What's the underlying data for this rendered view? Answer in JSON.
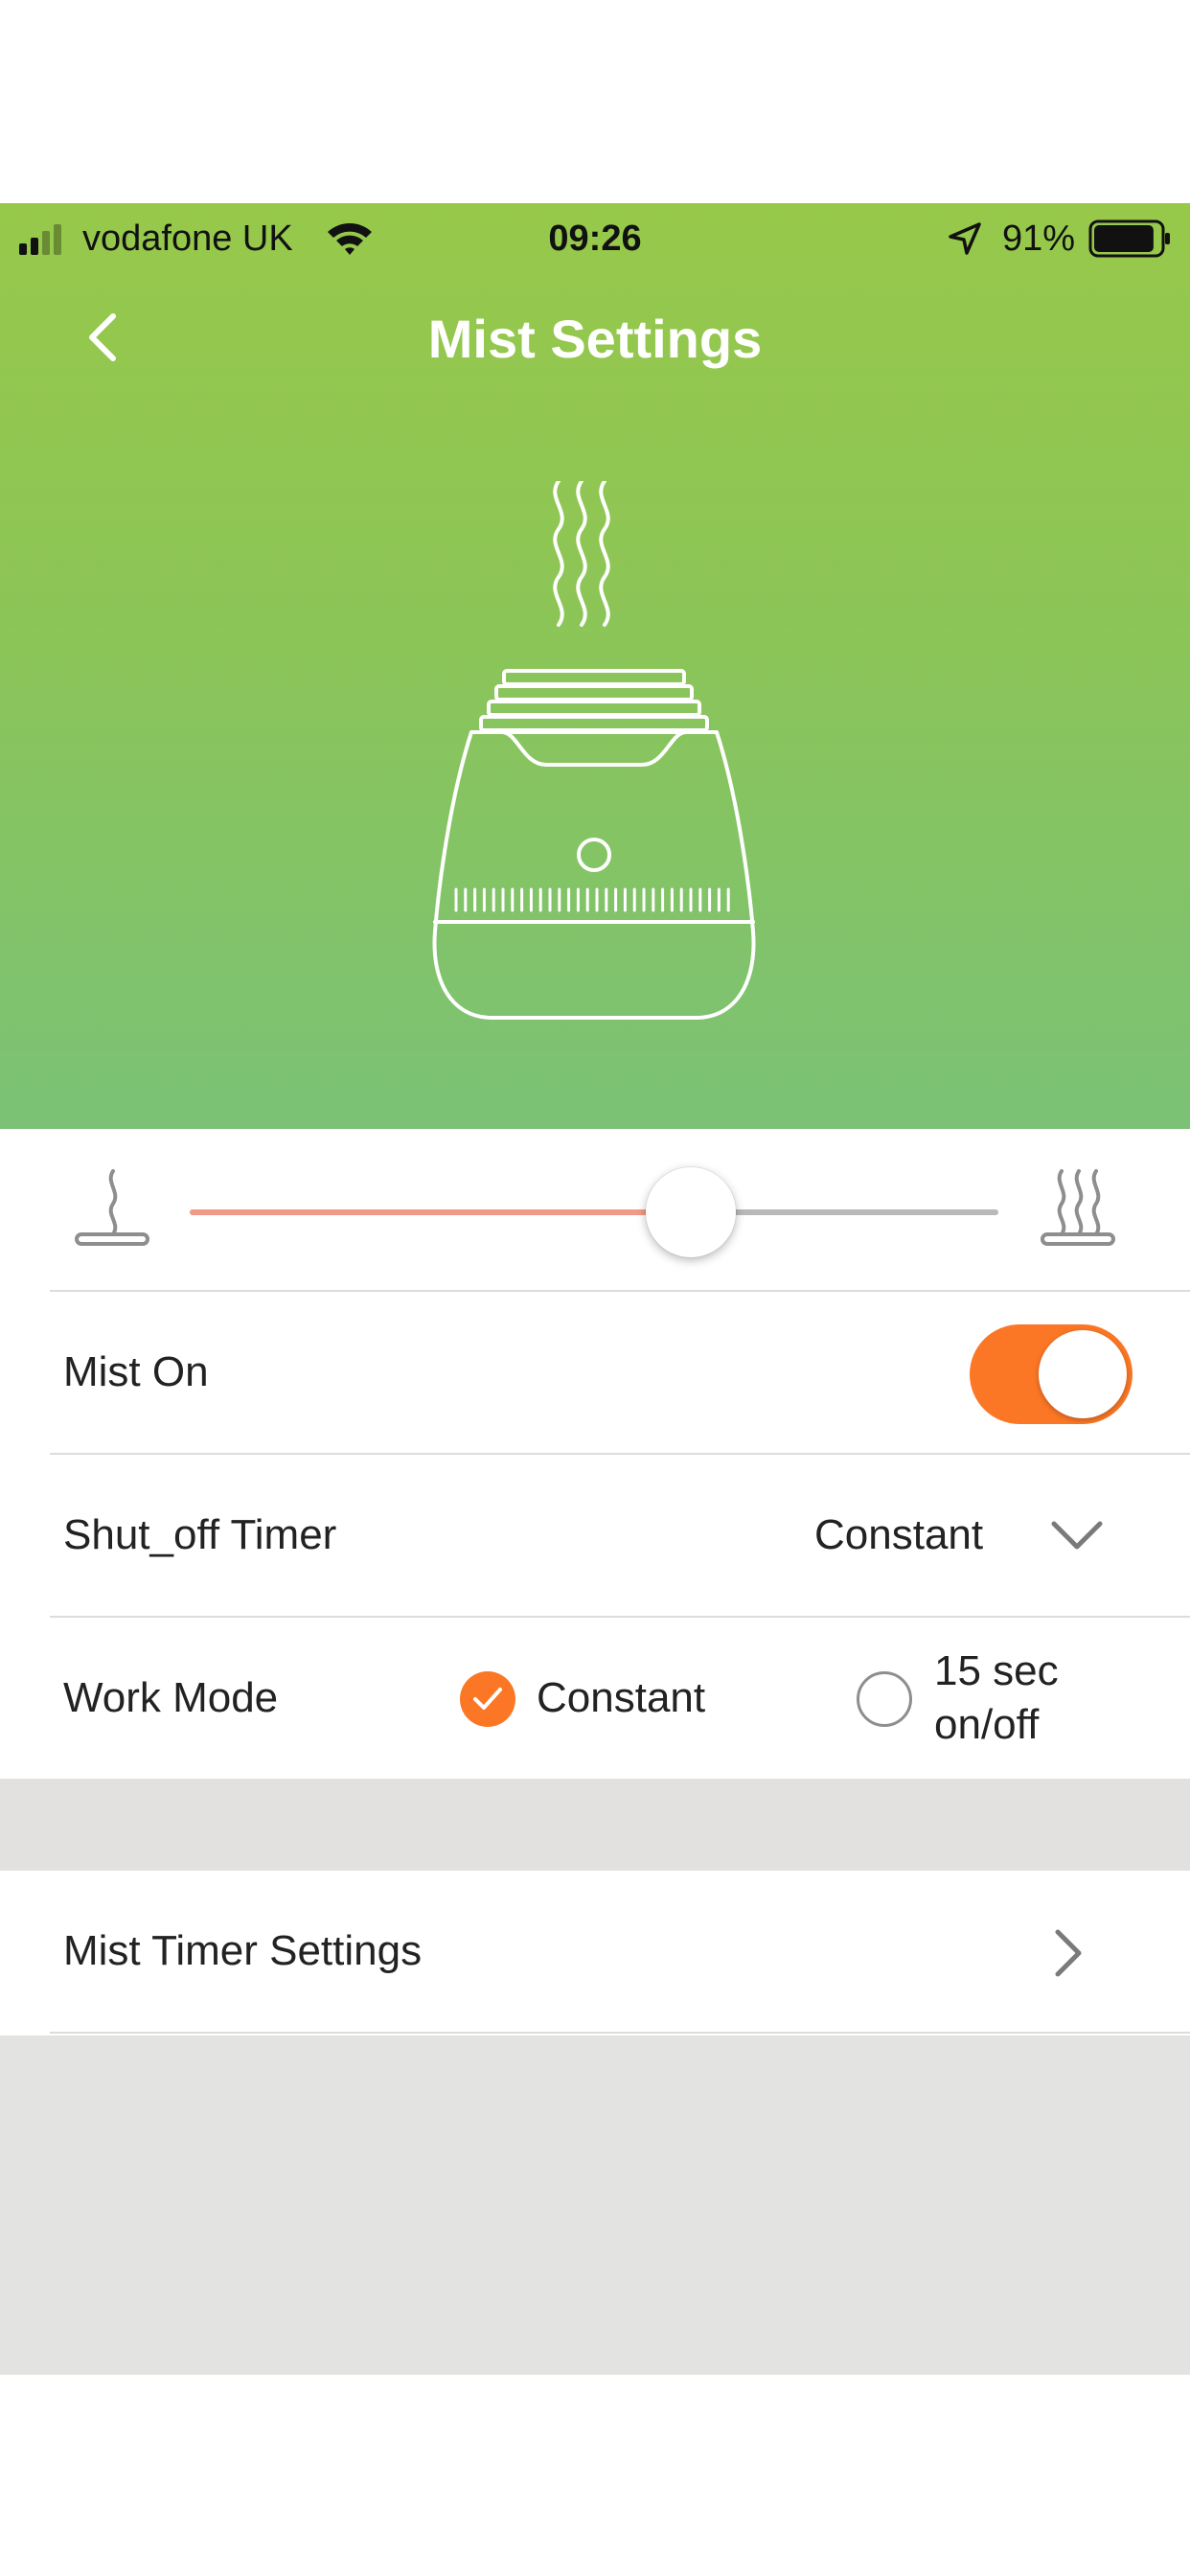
{
  "status_bar": {
    "carrier": "vodafone UK",
    "time": "09:26",
    "battery_percent": "91%",
    "battery_level": 0.91,
    "signal_bars_filled": 2,
    "signal_bars_total": 4
  },
  "header": {
    "title": "Mist Settings",
    "back_icon": "chevron-left-icon",
    "background_top": "#97c84a",
    "background_bottom": "#7bc276"
  },
  "device_illustration": {
    "icon": "humidifier-icon"
  },
  "mist_level": {
    "low_icon": "mist-low-icon",
    "high_icon": "mist-high-icon",
    "value_fraction": 0.62,
    "fill_color": "#f19a87"
  },
  "mist_on": {
    "label": "Mist On",
    "value": true,
    "accent": "#fb7725"
  },
  "shutoff_timer": {
    "label": "Shut_off Timer",
    "selected": "Constant",
    "icon": "chevron-down-icon"
  },
  "work_mode": {
    "label": "Work Mode",
    "options": [
      {
        "line1": "Constant",
        "line2": "",
        "checked": true
      },
      {
        "line1": "15 sec",
        "line2": "on/off",
        "checked": false
      }
    ]
  },
  "mist_timer_settings": {
    "label": "Mist Timer Settings",
    "icon": "chevron-right-icon"
  }
}
